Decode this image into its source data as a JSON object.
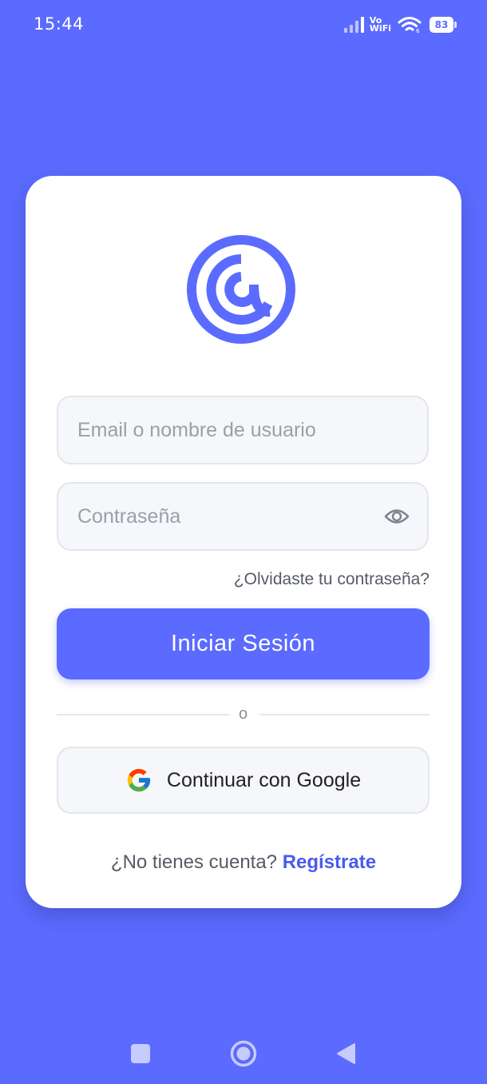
{
  "status_bar": {
    "time": "15:44",
    "network_label_top": "Vo",
    "network_label_bottom": "WiFi",
    "battery_percent": "83"
  },
  "form": {
    "email_placeholder": "Email o nombre de usuario",
    "password_placeholder": "Contraseña",
    "forgot_password": "¿Olvidaste tu contraseña?",
    "login_button": "Iniciar Sesión",
    "divider_text": "o",
    "google_button": "Continuar con Google",
    "no_account_text": "¿No tienes cuenta? ",
    "register_link": "Regístrate"
  },
  "colors": {
    "background": "#5B6BFF",
    "accent": "#5B6BFF",
    "link": "#4A5BEF",
    "card": "#FFFFFF",
    "field_bg": "#F6F7FA"
  },
  "icons": {
    "logo": "at-sign-logo",
    "password_toggle": "eye-icon",
    "google": "google-icon",
    "nav_recents": "square-icon",
    "nav_home": "circle-icon",
    "nav_back": "triangle-back-icon"
  }
}
